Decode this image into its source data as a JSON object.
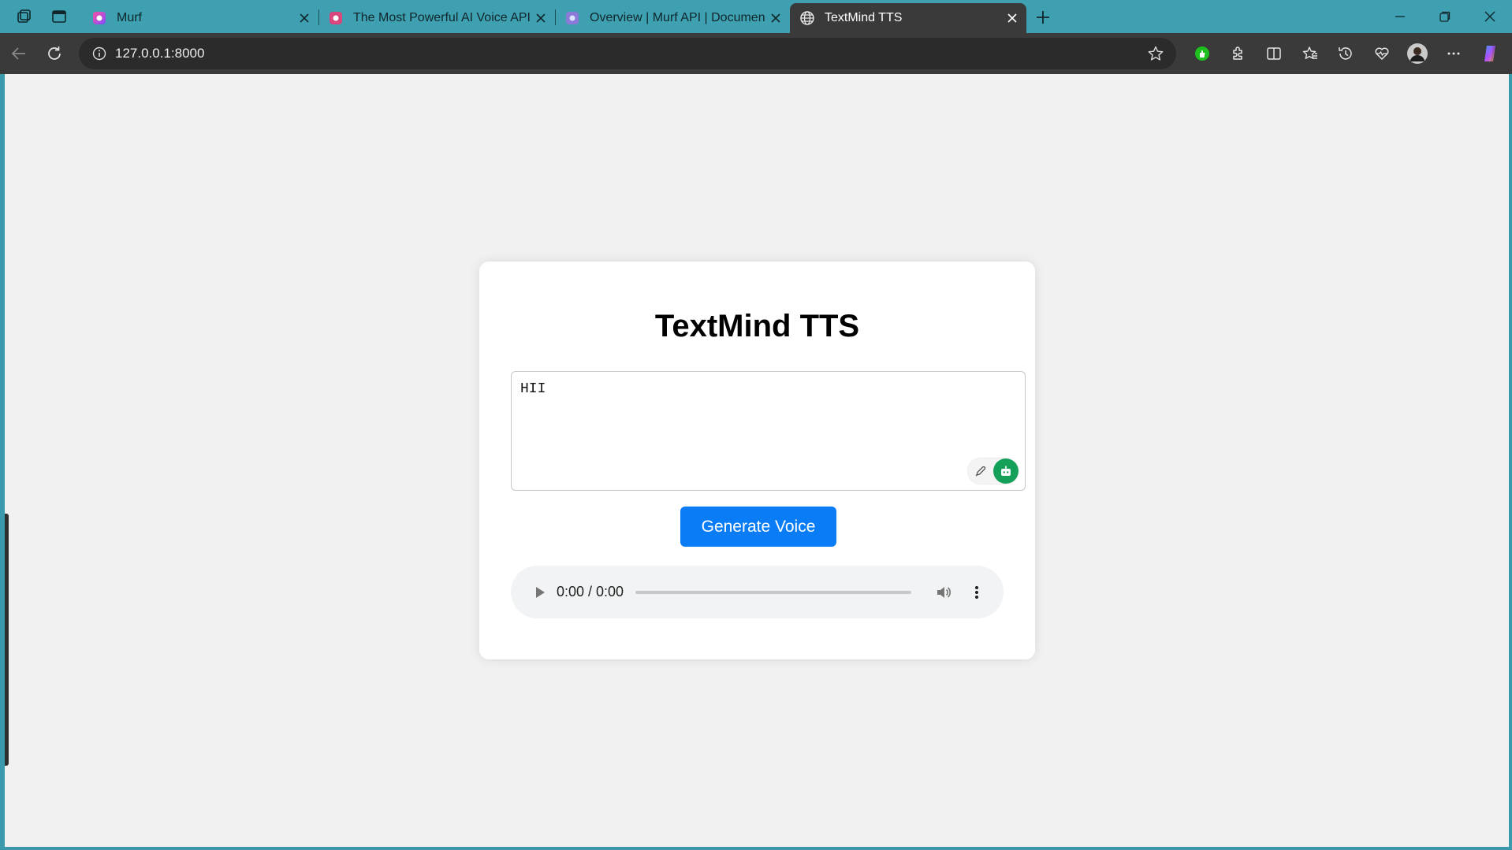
{
  "browser": {
    "tabs": [
      {
        "title": "Murf",
        "icon": "murf-favicon"
      },
      {
        "title": "The Most Powerful AI Voice API S",
        "icon": "murf-favicon"
      },
      {
        "title": "Overview | Murf API | Documentat",
        "icon": "murf-docs-favicon"
      },
      {
        "title": "TextMind TTS",
        "icon": "globe-icon",
        "active": true
      }
    ],
    "address": "127.0.0.1:8000",
    "accent_color": "#3ea0b1"
  },
  "app": {
    "title": "TextMind TTS",
    "textarea_value": "HII",
    "generate_label": "Generate Voice",
    "button_color": "#0a7cf5",
    "audio": {
      "time": "0:00 / 0:00",
      "progress": 0
    }
  }
}
